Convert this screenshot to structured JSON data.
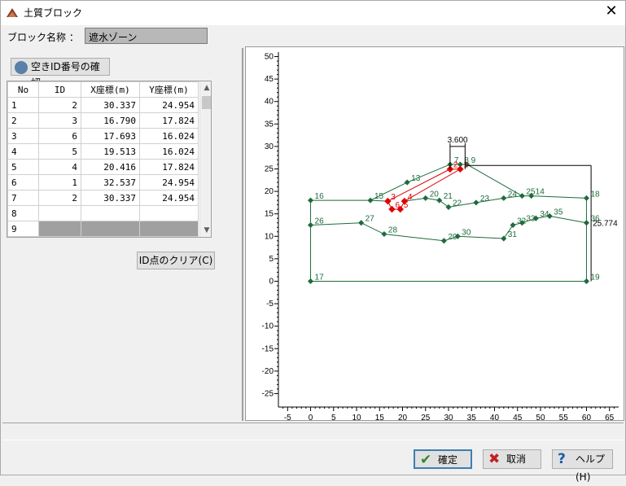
{
  "window": {
    "title": "土質ブロック",
    "close_label": "✕"
  },
  "block_name": {
    "label": "ブロック名称 ：",
    "value": "遮水ゾーン"
  },
  "left": {
    "check_button": "空きID番号の確認",
    "clear_button": "ID点のクリア(C)"
  },
  "table": {
    "headers": [
      "No",
      "ID",
      "X座標(m)",
      "Y座標(m)"
    ],
    "rows": [
      [
        "1",
        "2",
        "30.337",
        "24.954"
      ],
      [
        "2",
        "3",
        "16.790",
        "17.824"
      ],
      [
        "3",
        "6",
        "17.693",
        "16.024"
      ],
      [
        "4",
        "5",
        "19.513",
        "16.024"
      ],
      [
        "5",
        "4",
        "20.416",
        "17.824"
      ],
      [
        "6",
        "1",
        "32.537",
        "24.954"
      ],
      [
        "7",
        "2",
        "30.337",
        "24.954"
      ],
      [
        "8",
        "",
        "",
        ""
      ],
      [
        "9",
        "",
        "",
        ""
      ]
    ]
  },
  "plot": {
    "y_ticks": [
      "50",
      "45",
      "40",
      "35",
      "30",
      "25",
      "20",
      "15",
      "10",
      "5",
      "0",
      "-5",
      "-10",
      "-15",
      "-20",
      "-25"
    ],
    "x_ticks": [
      "-5",
      "0",
      "5",
      "10",
      "15",
      "20",
      "25",
      "30",
      "35",
      "40",
      "45",
      "50",
      "55",
      "60",
      "65"
    ],
    "dim_top": "3.600",
    "dim_right": "25.774",
    "colors": {
      "section": "#1e6b3c",
      "block": "#e00000",
      "dim": "#000000"
    }
  },
  "chart_data": {
    "type": "scatter",
    "series": [
      {
        "values": [
          {
            "id": "1",
            "x": 32.537,
            "y": 24.954
          },
          {
            "id": "2",
            "x": 30.337,
            "y": 24.954
          },
          {
            "id": "3",
            "x": 16.79,
            "y": 17.824
          },
          {
            "id": "4",
            "x": 20.416,
            "y": 17.824
          },
          {
            "id": "5",
            "x": 19.513,
            "y": 16.024
          },
          {
            "id": "6",
            "x": 17.693,
            "y": 16.024
          }
        ]
      },
      {
        "values": [
          {
            "id": "7",
            "x": 30.337,
            "y": 26
          },
          {
            "id": "8",
            "x": 32.537,
            "y": 26
          },
          {
            "id": "9",
            "x": 34,
            "y": 26
          },
          {
            "id": "13",
            "x": 21,
            "y": 22
          },
          {
            "id": "15",
            "x": 13,
            "y": 18
          },
          {
            "id": "16",
            "x": 0,
            "y": 18
          },
          {
            "id": "17",
            "x": 0,
            "y": 0
          },
          {
            "id": "18",
            "x": 60,
            "y": 18.5
          },
          {
            "id": "19",
            "x": 60,
            "y": 0
          },
          {
            "id": "20",
            "x": 25,
            "y": 18.5
          },
          {
            "id": "21",
            "x": 28,
            "y": 18
          },
          {
            "id": "22",
            "x": 30,
            "y": 16.5
          },
          {
            "id": "23",
            "x": 36,
            "y": 17.5
          },
          {
            "id": "24",
            "x": 42,
            "y": 18.5
          },
          {
            "id": "25",
            "x": 46,
            "y": 19
          },
          {
            "id": "14",
            "x": 48,
            "y": 19
          },
          {
            "id": "26",
            "x": 0,
            "y": 12.5
          },
          {
            "id": "27",
            "x": 11,
            "y": 13
          },
          {
            "id": "28",
            "x": 16,
            "y": 10.5
          },
          {
            "id": "29",
            "x": 29,
            "y": 9
          },
          {
            "id": "30",
            "x": 32,
            "y": 10
          },
          {
            "id": "31",
            "x": 42,
            "y": 9.5
          },
          {
            "id": "32",
            "x": 44,
            "y": 12.5
          },
          {
            "id": "33",
            "x": 46,
            "y": 13
          },
          {
            "id": "34",
            "x": 49,
            "y": 14
          },
          {
            "id": "35",
            "x": 52,
            "y": 14.5
          },
          {
            "id": "36",
            "x": 60,
            "y": 13
          }
        ]
      }
    ],
    "xlim": [
      -7,
      67
    ],
    "ylim": [
      -28,
      51
    ]
  },
  "footer": {
    "ok": "確定",
    "cancel": "取消",
    "help": "ヘルプ(H)"
  }
}
